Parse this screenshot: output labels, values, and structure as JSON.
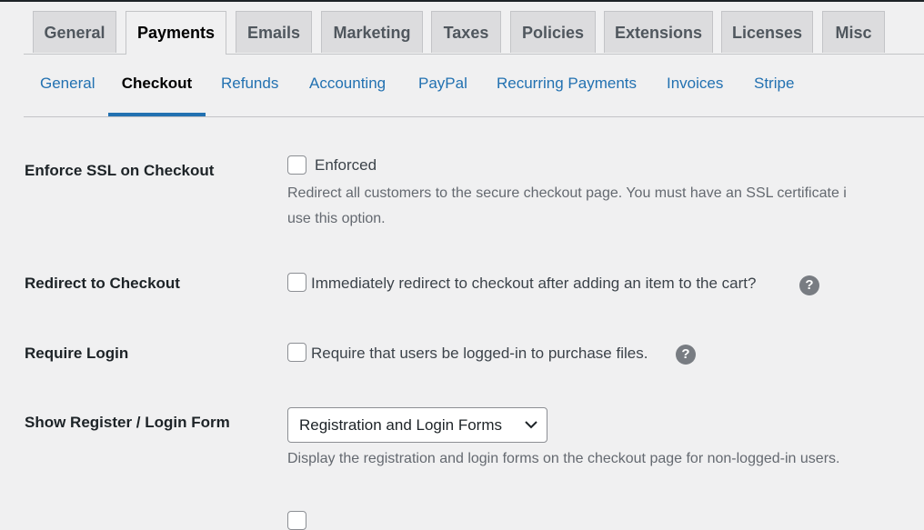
{
  "main_tabs": [
    "General",
    "Payments",
    "Emails",
    "Marketing",
    "Taxes",
    "Policies",
    "Extensions",
    "Licenses",
    "Misc"
  ],
  "sub_tabs": [
    "General",
    "Checkout",
    "Refunds",
    "Accounting",
    "PayPal",
    "Recurring Payments",
    "Invoices",
    "Stripe"
  ],
  "settings": {
    "enforce_ssl": {
      "label": "Enforce SSL on Checkout",
      "checkbox_label": "Enforced",
      "desc_line1": "Redirect all customers to the secure checkout page. You must have an SSL certificate i",
      "desc_line2": "use this option."
    },
    "redirect_checkout": {
      "label": "Redirect to Checkout",
      "checkbox_label": "Immediately redirect to checkout after adding an item to the cart?",
      "help": "?"
    },
    "require_login": {
      "label": "Require Login",
      "checkbox_label": "Require that users be logged-in to purchase files.",
      "help": "?"
    },
    "register_form": {
      "label": "Show Register / Login Form",
      "selected": "Registration and Login Forms",
      "desc": "Display the registration and login forms on the checkout page for non-logged-in users."
    }
  }
}
